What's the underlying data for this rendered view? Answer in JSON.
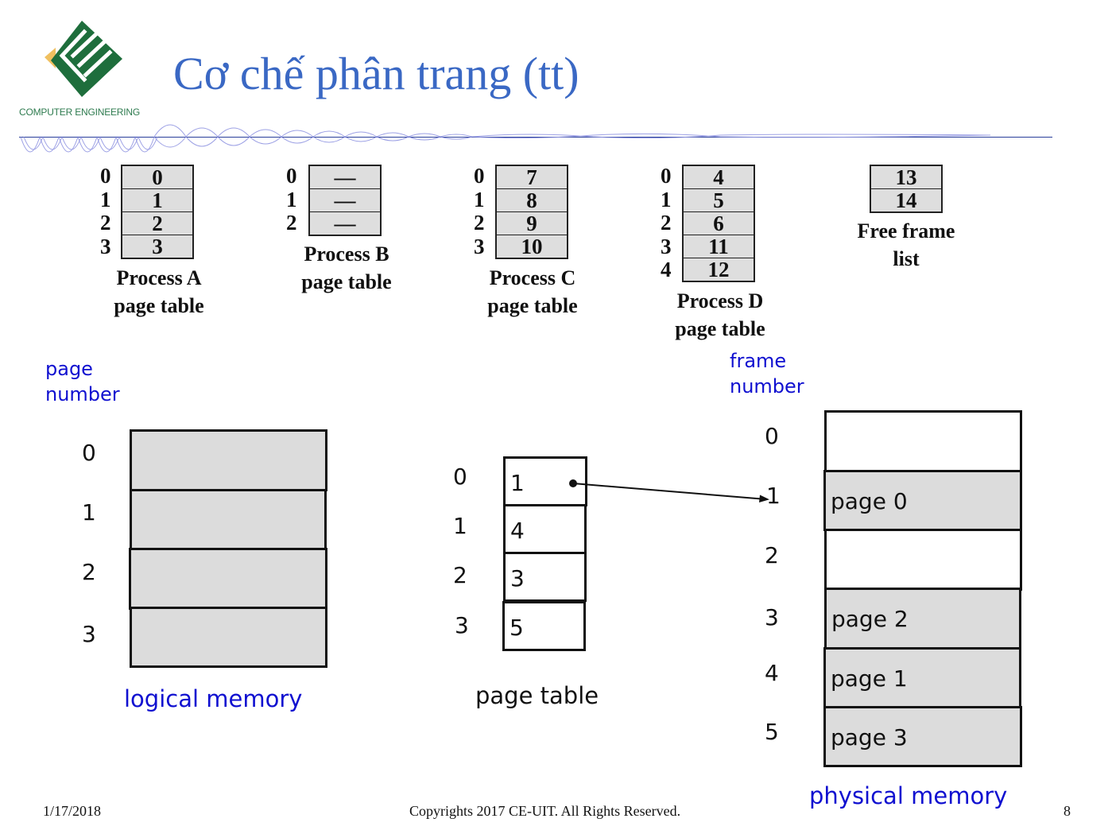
{
  "header": {
    "logo_text": "COMPUTER ENGINEERING",
    "title": "Cơ chế phân trang (tt)"
  },
  "process_tables": [
    {
      "name": "Process A",
      "caption_line1": "Process A",
      "caption_line2": "page table",
      "rows": [
        {
          "index": "0",
          "frame": "0"
        },
        {
          "index": "1",
          "frame": "1"
        },
        {
          "index": "2",
          "frame": "2"
        },
        {
          "index": "3",
          "frame": "3"
        }
      ]
    },
    {
      "name": "Process B",
      "caption_line1": "Process B",
      "caption_line2": "page table",
      "rows": [
        {
          "index": "0",
          "frame": "—"
        },
        {
          "index": "1",
          "frame": "—"
        },
        {
          "index": "2",
          "frame": "—"
        }
      ]
    },
    {
      "name": "Process C",
      "caption_line1": "Process C",
      "caption_line2": "page table",
      "rows": [
        {
          "index": "0",
          "frame": "7"
        },
        {
          "index": "1",
          "frame": "8"
        },
        {
          "index": "2",
          "frame": "9"
        },
        {
          "index": "3",
          "frame": "10"
        }
      ]
    },
    {
      "name": "Process D",
      "caption_line1": "Process D",
      "caption_line2": "page table",
      "rows": [
        {
          "index": "0",
          "frame": "4"
        },
        {
          "index": "1",
          "frame": "5"
        },
        {
          "index": "2",
          "frame": "6"
        },
        {
          "index": "3",
          "frame": "11"
        },
        {
          "index": "4",
          "frame": "12"
        }
      ]
    }
  ],
  "free_frame_list": {
    "frames": [
      "13",
      "14"
    ],
    "caption_line1": "Free frame",
    "caption_line2": "list"
  },
  "logical_memory": {
    "axis_label_line1": "page",
    "axis_label_line2": "number",
    "pages": [
      "0",
      "1",
      "2",
      "3"
    ],
    "caption": "logical memory"
  },
  "page_table": {
    "rows": [
      {
        "index": "0",
        "frame": "1"
      },
      {
        "index": "1",
        "frame": "4"
      },
      {
        "index": "2",
        "frame": "3"
      },
      {
        "index": "3",
        "frame": "5"
      }
    ],
    "caption": "page table",
    "arrow": {
      "from_page": "0",
      "to_frame": "1"
    }
  },
  "physical_memory": {
    "axis_label_line1": "frame",
    "axis_label_line2": "number",
    "frames": [
      {
        "index": "0",
        "content": "",
        "occupied": false
      },
      {
        "index": "1",
        "content": "page 0",
        "occupied": true
      },
      {
        "index": "2",
        "content": "",
        "occupied": false
      },
      {
        "index": "3",
        "content": "page 2",
        "occupied": true
      },
      {
        "index": "4",
        "content": "page 1",
        "occupied": true
      },
      {
        "index": "5",
        "content": "page 3",
        "occupied": true
      }
    ],
    "caption": "physical memory"
  },
  "footer": {
    "date": "1/17/2018",
    "copyright": "Copyrights 2017 CE-UIT. All Rights Reserved.",
    "page_number": "8"
  },
  "colors": {
    "title": "#3a68c4",
    "label_blue": "#1010d0",
    "cell_gray": "#dcdcdc",
    "logo_green": "#1e6e3c",
    "logo_yellow": "#f0c060"
  }
}
